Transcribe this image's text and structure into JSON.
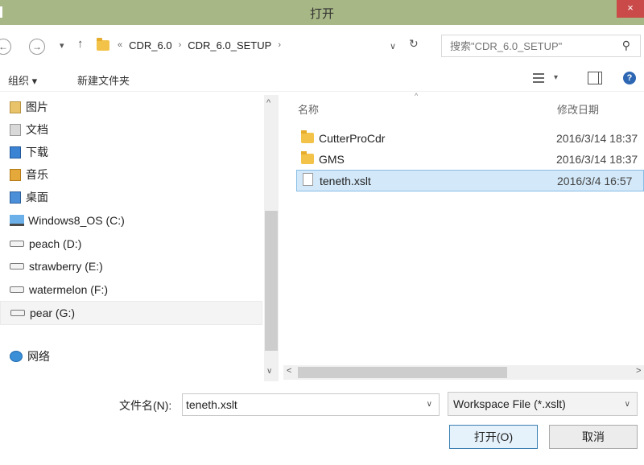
{
  "window": {
    "title": "打开",
    "close_label": "×"
  },
  "nav": {
    "back_icon": "back-arrow-icon",
    "forward_icon": "forward-arrow-icon",
    "recent_dd": "▾",
    "up": "↑"
  },
  "address": {
    "overflow": "«",
    "crumbs": [
      "CDR_6.0",
      "CDR_6.0_SETUP"
    ],
    "separator": "›",
    "dropdown": "∨",
    "refresh": "↻"
  },
  "search": {
    "placeholder": "搜索\"CDR_6.0_SETUP\"",
    "icon": "⚲"
  },
  "toolbar": {
    "organize": "组织 ▾",
    "new_folder": "新建文件夹",
    "view_dd": "▾",
    "help": "?"
  },
  "sidebar": {
    "items": [
      {
        "label": "图片",
        "icon": "pictures-icon"
      },
      {
        "label": "文档",
        "icon": "documents-icon"
      },
      {
        "label": "下载",
        "icon": "downloads-icon"
      },
      {
        "label": "音乐",
        "icon": "music-icon"
      },
      {
        "label": "桌面",
        "icon": "desktop-icon"
      },
      {
        "label": "Windows8_OS (C:)",
        "icon": "os-drive-icon"
      },
      {
        "label": "peach (D:)",
        "icon": "drive-icon"
      },
      {
        "label": "strawberry (E:)",
        "icon": "drive-icon"
      },
      {
        "label": "watermelon (F:)",
        "icon": "drive-icon"
      },
      {
        "label": "pear (G:)",
        "icon": "drive-icon"
      },
      {
        "label": "网络",
        "icon": "network-icon"
      }
    ],
    "selected": "pear (G:)",
    "scroll_up": "^",
    "scroll_down": "∨"
  },
  "file_list": {
    "columns": {
      "name": "名称",
      "date": "修改日期"
    },
    "sort_arrow": "^",
    "rows": [
      {
        "name": "CutterProCdr",
        "date": "2016/3/14 18:37",
        "type": "folder"
      },
      {
        "name": "GMS",
        "date": "2016/3/14 18:37",
        "type": "folder"
      },
      {
        "name": "teneth.xslt",
        "date": "2016/3/4 16:57",
        "type": "file"
      }
    ],
    "hscroll_left": "<",
    "hscroll_right": ">"
  },
  "filename": {
    "label": "文件名(N):",
    "value": "teneth.xslt",
    "dropdown": "∨"
  },
  "filetype": {
    "selected": "Workspace File (*.xslt)",
    "dropdown": "∨"
  },
  "buttons": {
    "open": "打开(O)",
    "cancel": "取消"
  }
}
